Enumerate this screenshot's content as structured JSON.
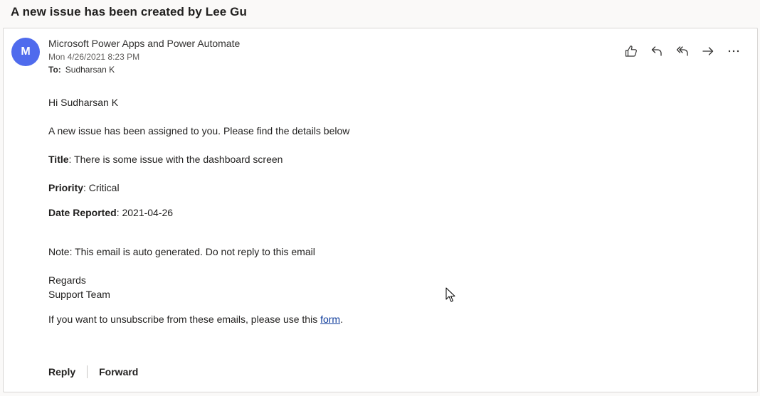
{
  "subject": "A new issue has been created by Lee Gu",
  "sender": {
    "avatar_letter": "M",
    "name": "Microsoft Power Apps and Power Automate",
    "date": "Mon 4/26/2021 8:23 PM",
    "to_label": "To:",
    "to_name": "Sudharsan K"
  },
  "actions": [
    {
      "name": "like",
      "icon": "thumbs-up-icon"
    },
    {
      "name": "reply",
      "icon": "reply-icon"
    },
    {
      "name": "reply-all",
      "icon": "reply-all-icon"
    },
    {
      "name": "forward",
      "icon": "forward-arrow-icon"
    },
    {
      "name": "more",
      "icon": "more-ellipsis-icon"
    }
  ],
  "body": {
    "greeting": "Hi Sudharsan K",
    "intro": "A new issue has been assigned to you. Please find the details below",
    "title_label": "Title",
    "title_value": ": There is some issue with the dashboard screen",
    "priority_label": "Priority",
    "priority_value": ": Critical",
    "date_label": "Date Reported",
    "date_value": ": 2021-04-26",
    "note": "Note: This email is auto generated. Do not reply to this email",
    "regards": "Regards",
    "team": "Support Team",
    "unsubscribe_text": "If you want to unsubscribe from these emails, please use this ",
    "unsubscribe_link": "form",
    "unsubscribe_end": "."
  },
  "footer": {
    "reply_label": "Reply",
    "forward_label": "Forward"
  },
  "colors": {
    "avatar": "#4f6bed",
    "link": "#0f3c9b",
    "background": "#faf9f8"
  }
}
